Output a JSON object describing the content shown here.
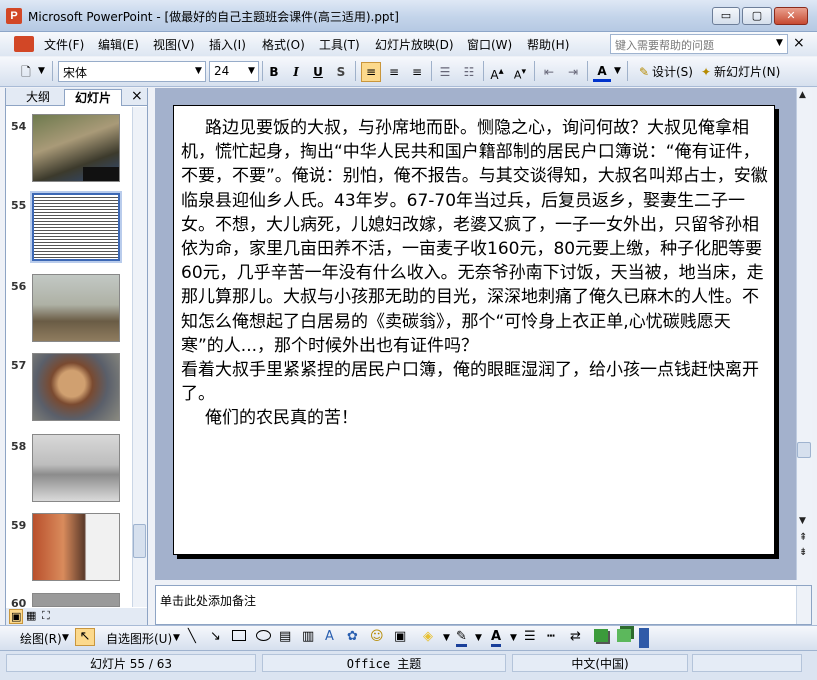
{
  "window": {
    "app_icon": "P",
    "title": "Microsoft PowerPoint - [做最好的自己主题班会课件(高三适用).ppt]",
    "minimize_glyph": "▭",
    "restore_glyph": "▢",
    "close_glyph": "✕"
  },
  "menu": {
    "items": [
      "文件(F)",
      "编辑(E)",
      "视图(V)",
      "插入(I)",
      "格式(O)",
      "工具(T)",
      "幻灯片放映(D)",
      "窗口(W)",
      "帮助(H)"
    ],
    "help_placeholder": "键入需要帮助的问题",
    "doc_close": "×"
  },
  "toolbar": {
    "font_name": "宋体",
    "font_size": "24",
    "bold": "B",
    "italic": "I",
    "underline": "U",
    "shadow": "S",
    "design_label": "设计(S)",
    "new_slide_label": "新幻灯片(N)"
  },
  "panel": {
    "tab_outline": "大纲",
    "tab_slides": "幻灯片",
    "close_glyph": "×",
    "thumb_numbers": [
      "54",
      "55",
      "56",
      "57",
      "58",
      "59",
      "60"
    ]
  },
  "slide": {
    "paragraphs": [
      "路边见要饭的大叔，与孙席地而卧。恻隐之心，询问何故？大叔见俺拿相机，慌忙起身，掏出“中华人民共和国户籍部制的居民户口簿说：“俺有证件，不要，不要”。俺说：别怕，俺不报告。与其交谈得知，大叔名叫郑占士，安徽临泉县迎仙乡人氏。43年岁。67-70年当过兵，后复员返乡，娶妻生二子一女。不想，大儿病死，儿媳妇改嫁，老婆又疯了，一子一女外出，只留爷孙相依为命，家里几亩田养不活，一亩麦子收160元，80元要上缴，种子化肥等要60元，几乎辛苦一年没有什么收入。无奈爷孙南下讨饭，天当被，地当床，走那儿算那儿。大叔与小孩那无助的目光，深深地刺痛了俺久已麻木的人性。不知怎么俺想起了白居易的《卖碳翁》，那个“可怜身上衣正单,心忧碳贱愿天寒”的人...，那个时候外出也有证件吗？",
      "看着大叔手里紧紧捏的居民户口簿，俺的眼眶湿润了，给小孩一点钱赶快离开了。",
      "俺们的农民真的苦！"
    ]
  },
  "notes": {
    "placeholder": "单击此处添加备注"
  },
  "drawing": {
    "draw_label": "绘图(R)",
    "autoshape_label": "自选图形(U)"
  },
  "status": {
    "slide_indicator": "幻灯片 55 / 63",
    "theme": "Office 主题",
    "language": "中文(中国)"
  },
  "colors": {
    "accent": "#3c68b5",
    "slide_area_bg": "#a3b1cc",
    "close_btn": "#c74a32"
  }
}
